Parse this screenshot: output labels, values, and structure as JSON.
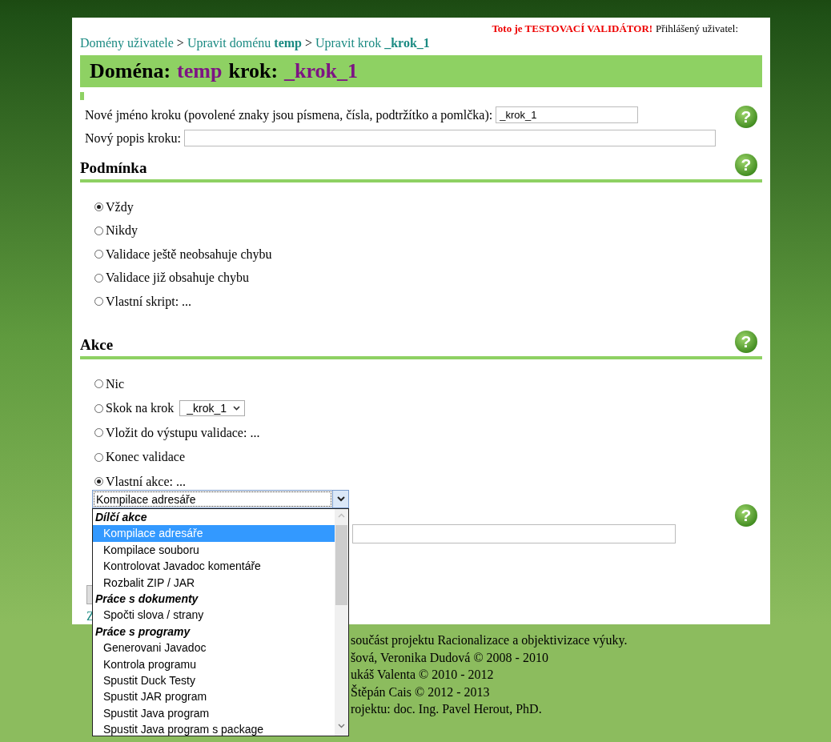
{
  "banner": {
    "warning": "Toto je TESTOVACÍ VALIDÁTOR!",
    "user_label": "Přihlášený uživatel:"
  },
  "breadcrumb": [
    {
      "text": "Domény uživatele"
    },
    {
      "sep": ">",
      "text": "Upravit doménu **temp**"
    },
    {
      "sep": ">",
      "text": "Upravit krok **_krok_1**"
    }
  ],
  "heading": {
    "domain_label": "Doména:",
    "domain": "temp",
    "step_label": "krok:",
    "step": "_krok_1"
  },
  "form": {
    "name_label": "Nové jméno kroku (povolené znaky jsou písmena, čísla, podtržítko a pomlčka):",
    "name_value": "_krok_1",
    "description_label": "Nový popis kroku:",
    "help": "?"
  },
  "condition": {
    "title": "Podmínka",
    "help": "?",
    "options": [
      {
        "label": "Vždy",
        "selected": true
      },
      {
        "label": "Nikdy",
        "selected": false
      },
      {
        "label": "Validace ještě neobsahuje chybu",
        "selected": false
      },
      {
        "label": "Validace již obsahuje chybu",
        "selected": false
      },
      {
        "label": "Vlastní skript: ...",
        "selected": false
      }
    ]
  },
  "action": {
    "title": "Akce",
    "help": "?",
    "options": [
      {
        "kind": "plain",
        "label": "Nic",
        "selected": false
      },
      {
        "kind": "select",
        "label": "Skok na krok",
        "value": "_krok_1",
        "selected": false
      },
      {
        "kind": "plain",
        "label": "Vložit do výstupu validace: ...",
        "selected": false
      },
      {
        "kind": "plain",
        "label": "Konec validace",
        "selected": false
      },
      {
        "kind": "plain",
        "label": "Vlastní akce: ...",
        "selected": true
      }
    ],
    "script_help": "?",
    "back_link": "Z"
  },
  "dropdown": {
    "value": "Kompilace adresáře",
    "groups": [
      {
        "label": "Dílčí akce",
        "items": [
          {
            "text": "Kompilace adresáře",
            "selected": true
          },
          {
            "text": "Kompilace souboru",
            "selected": false
          },
          {
            "text": "Kontrolovat Javadoc komentáře",
            "selected": false
          },
          {
            "text": "Rozbalit ZIP / JAR",
            "selected": false
          }
        ]
      },
      {
        "label": "Práce s dokumenty",
        "items": [
          {
            "text": "Spočti slova / strany",
            "selected": false
          }
        ]
      },
      {
        "label": "Práce s programy",
        "items": [
          {
            "text": "Generovani Javadoc",
            "selected": false
          },
          {
            "text": "Kontrola programu",
            "selected": false
          },
          {
            "text": "Spustit Duck Testy",
            "selected": false
          },
          {
            "text": "Spustit JAR program",
            "selected": false
          },
          {
            "text": "Spustit Java program",
            "selected": false
          },
          {
            "text": "Spustit Java program s package",
            "selected": false
          }
        ]
      }
    ]
  },
  "footer": [
    "součást projektu Racionalizace a objektivizace výuky.",
    "šová, Veronika Dudová © 2008 - 2010",
    "ukáš Valenta © 2010 - 2012",
    "Štěpán Cais © 2012 - 2013",
    "rojektu: doc. Ing. Pavel Herout, PhD."
  ]
}
